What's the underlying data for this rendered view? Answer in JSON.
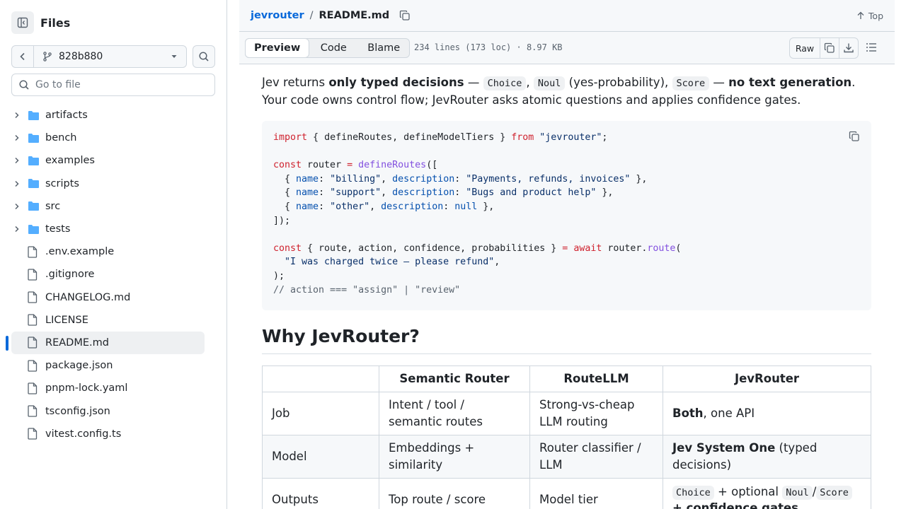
{
  "sidebar": {
    "title": "Files",
    "branch": "828b880",
    "goto_placeholder": "Go to file",
    "tree": [
      {
        "name": "artifacts",
        "type": "folder"
      },
      {
        "name": "bench",
        "type": "folder"
      },
      {
        "name": "examples",
        "type": "folder"
      },
      {
        "name": "scripts",
        "type": "folder"
      },
      {
        "name": "src",
        "type": "folder"
      },
      {
        "name": "tests",
        "type": "folder"
      },
      {
        "name": ".env.example",
        "type": "file"
      },
      {
        "name": ".gitignore",
        "type": "file"
      },
      {
        "name": "CHANGELOG.md",
        "type": "file"
      },
      {
        "name": "LICENSE",
        "type": "file"
      },
      {
        "name": "README.md",
        "type": "file",
        "selected": true
      },
      {
        "name": "package.json",
        "type": "file"
      },
      {
        "name": "pnpm-lock.yaml",
        "type": "file"
      },
      {
        "name": "tsconfig.json",
        "type": "file"
      },
      {
        "name": "vitest.config.ts",
        "type": "file"
      }
    ]
  },
  "header": {
    "repo": "jevrouter",
    "separator": "/",
    "file": "README.md",
    "top_label": "Top"
  },
  "toolbar": {
    "tabs": [
      "Preview",
      "Code",
      "Blame"
    ],
    "meta": "234 lines (173 loc) · 8.97 KB",
    "raw_label": "Raw"
  },
  "readme": {
    "intro": {
      "t1": "Jev returns ",
      "b1": "only typed decisions",
      "t2": " — ",
      "c1": "Choice",
      "t3": ", ",
      "c2": "Noul",
      "t4": " (yes-probability), ",
      "c3": "Score",
      "t5": " — ",
      "b2": "no text generation",
      "t6": ". Your code owns control flow; JevRouter asks atomic questions and applies confidence gates."
    },
    "code_lines": [
      "import { defineRoutes, defineModelTiers } from \"jevrouter\";",
      "",
      "const router = defineRoutes([",
      "  { name: \"billing\", description: \"Payments, refunds, invoices\" },",
      "  { name: \"support\", description: \"Bugs and product help\" },",
      "  { name: \"other\", description: null },",
      "]);",
      "",
      "const { route, action, confidence, probabilities } = await router.route(",
      "  \"I was charged twice — please refund\",",
      ");",
      "// action === \"assign\" | \"review\""
    ],
    "heading": "Why JevRouter?",
    "table": {
      "headers": [
        "",
        "Semantic Router",
        "RouteLLM",
        "JevRouter"
      ],
      "rows": [
        {
          "c0": "Job",
          "c1": "Intent / tool / semantic routes",
          "c2": "Strong-vs-cheap LLM routing",
          "c3b": "Both",
          "c3": ", one API"
        },
        {
          "c0": "Model",
          "c1": "Embeddings + similarity",
          "c2": "Router classifier / LLM",
          "c3b": "Jev System One",
          "c3": " (typed decisions)"
        },
        {
          "c0": "Outputs",
          "c1": "Top route / score",
          "c2": "Model tier",
          "o1": "Choice",
          "o2": " + optional ",
          "o3": "Noul",
          "o4": "/",
          "o5": "Score",
          "o6": "+ confidence gates"
        }
      ]
    }
  }
}
